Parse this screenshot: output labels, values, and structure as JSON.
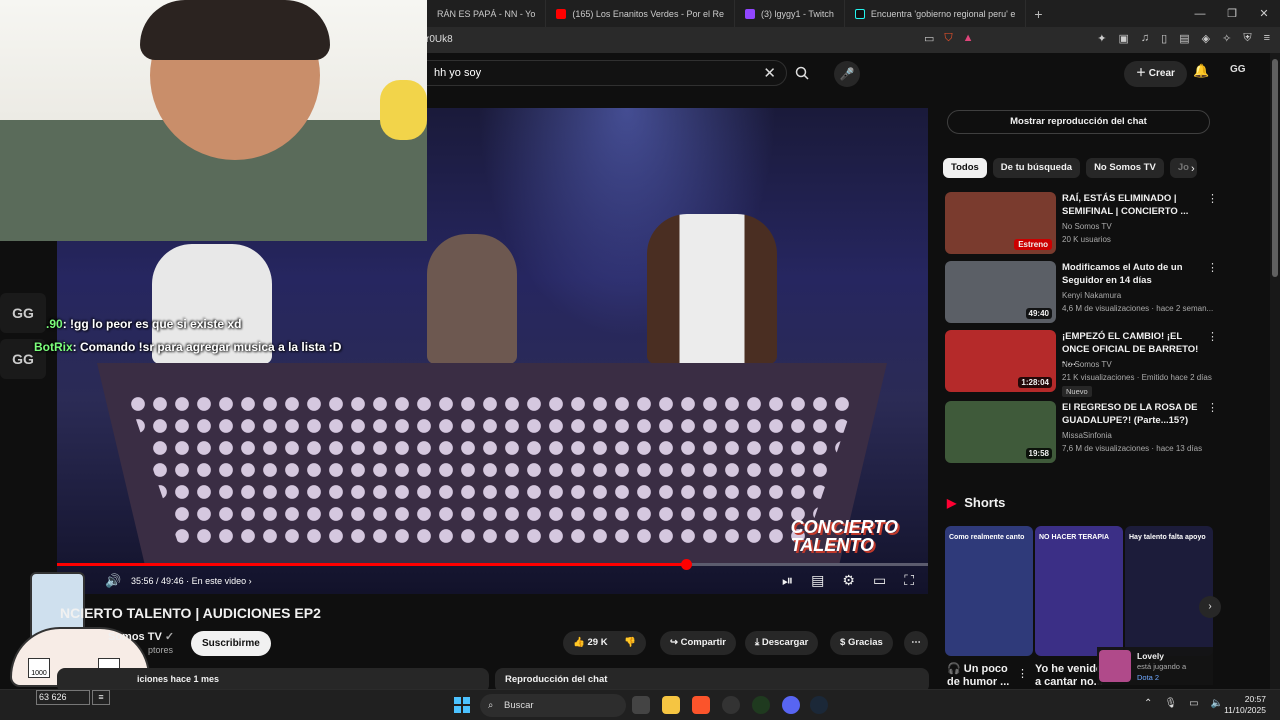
{
  "browser": {
    "tabs": [
      {
        "label": "RÁN ES PAPÁ - NN - Yo",
        "color": "#888888"
      },
      {
        "label": "(165) Los Enanitos Verdes - Por el Re",
        "color": "#ff0000"
      },
      {
        "label": "(3) lgygy1 - Twitch",
        "color": "#9146ff"
      },
      {
        "label": "Encuentra 'gobierno regional peru' e",
        "color": "#25f4ee"
      }
    ],
    "url": "r0Uk8"
  },
  "youtube": {
    "search_query": "hh yo soy",
    "create_label": "Crear",
    "user_initials": "GG"
  },
  "stream_overlay": {
    "chat": [
      {
        "user": ".90",
        "text": ": !gg lo peor es que si existe xd"
      },
      {
        "user": "BotRix",
        "text": ": Comando !sr para agregar musica a la lista :D"
      }
    ],
    "logo_text": "GG",
    "counter_value": "63 626",
    "badge_count_1": "1000",
    "badge_count_2": "1000"
  },
  "player": {
    "current_time": "35:56",
    "duration": "49:46",
    "progress": 0.722,
    "chapter": "En este video",
    "watermark_1": "CONCIERTO",
    "watermark_2": "TALENTO"
  },
  "video_info": {
    "title": "NCIERTO TALENTO | AUDICIONES EP2",
    "channel": "Somos TV",
    "subscribers": "ptores",
    "subscribe_label": "Suscribirme",
    "likes": "29 K",
    "share_label": "Compartir",
    "download_label": "Descargar",
    "thanks_label": "Gracias",
    "description_preview": "iciones  hace 1 mes",
    "chat_replay_bar": "Reproducción del chat"
  },
  "sidebar": {
    "chat_replay_button": "Mostrar reproducción del chat",
    "chips": [
      "Todos",
      "De tu búsqueda",
      "No Somos TV",
      "Jo"
    ],
    "recommendations": [
      {
        "title": "RAÍ, ESTÁS ELIMINADO | SEMIFINAL | CONCIERTO ...",
        "channel": "No Somos TV",
        "meta": "20 K usuarios",
        "badge": "Estreno",
        "thumb": "#7a3b2e"
      },
      {
        "title": "Modificamos el Auto de un Seguidor en 14 días",
        "channel": "Kenyi Nakamura",
        "meta": "4,6 M de visualizaciones · hace 2 seman...",
        "badge": "49:40",
        "thumb": "#5b5f66"
      },
      {
        "title": "¡EMPEZÓ EL CAMBIO! ¡EL ONCE OFICIAL DE BARRETO! - ...",
        "channel": "No Somos TV",
        "meta": "21 K visualizaciones · Emitido hace 2 días",
        "badge": "1:28:04",
        "thumb": "#b52a2a",
        "tag": "Nuevo"
      },
      {
        "title": "El REGRESO DE LA ROSA DE GUADALUPE?! (Parte...15?)",
        "channel": "MissaSinfonia",
        "meta": "7,6 M de visualizaciones · hace 13 días",
        "badge": "19:58",
        "thumb": "#3f5a3a"
      }
    ],
    "shorts_heading": "Shorts",
    "shorts": [
      {
        "caption": "Como realmente canto",
        "title": "Un poco de humor ...",
        "color": "#2f3a7a"
      },
      {
        "caption": "NO HACER TERAPIA",
        "title": "Yo he venido a cantar no...",
        "color": "#3b2f86"
      },
      {
        "caption": "Hay talento falta apoyo",
        "title": "",
        "color": "#1c1c3a"
      }
    ]
  },
  "notification": {
    "name": "Lovely",
    "status": "está jugando a",
    "game": "Dota 2"
  },
  "taskbar": {
    "search_label": "Buscar",
    "time": "20:57",
    "date": "11/10/2025"
  }
}
